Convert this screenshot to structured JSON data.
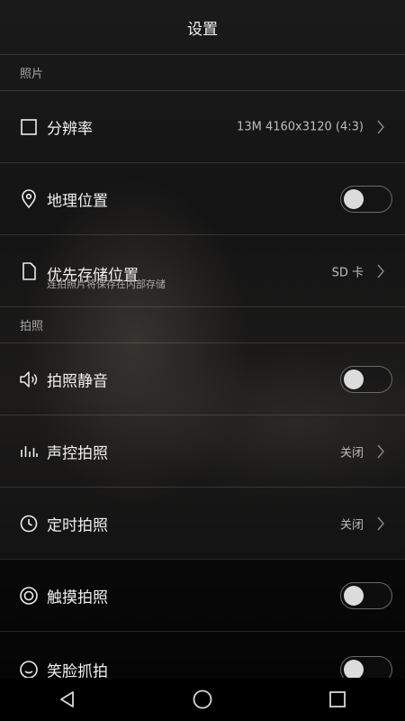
{
  "header": {
    "title": "设置"
  },
  "sections": {
    "photo": "照片",
    "shooting": "拍照"
  },
  "rows": {
    "resolution": {
      "label": "分辨率",
      "value": "13M 4160x3120 (4:3)",
      "icon": "square-icon"
    },
    "location": {
      "label": "地理位置",
      "toggle_on": false,
      "icon": "location-pin-icon"
    },
    "storage": {
      "label": "优先存储位置",
      "sublabel": "连拍照片将保存在内部存储",
      "value": "SD 卡",
      "icon": "file-icon"
    },
    "mute": {
      "label": "拍照静音",
      "toggle_on": false,
      "icon": "speaker-icon"
    },
    "voice": {
      "label": "声控拍照",
      "value": "关闭",
      "icon": "equalizer-icon"
    },
    "timer": {
      "label": "定时拍照",
      "value": "关闭",
      "icon": "clock-icon"
    },
    "touch": {
      "label": "触摸拍照",
      "toggle_on": false,
      "icon": "target-icon"
    },
    "smile": {
      "label": "笑脸抓拍",
      "toggle_on": false,
      "icon": "smile-icon"
    }
  },
  "navbar": {
    "icons": [
      "back-triangle-icon",
      "home-circle-icon",
      "recents-square-icon"
    ]
  },
  "colors": {
    "background": "#0d0d0d",
    "text": "#f0f0f0",
    "subtext": "#a8a8a8",
    "divider": "#3a3a3a"
  }
}
